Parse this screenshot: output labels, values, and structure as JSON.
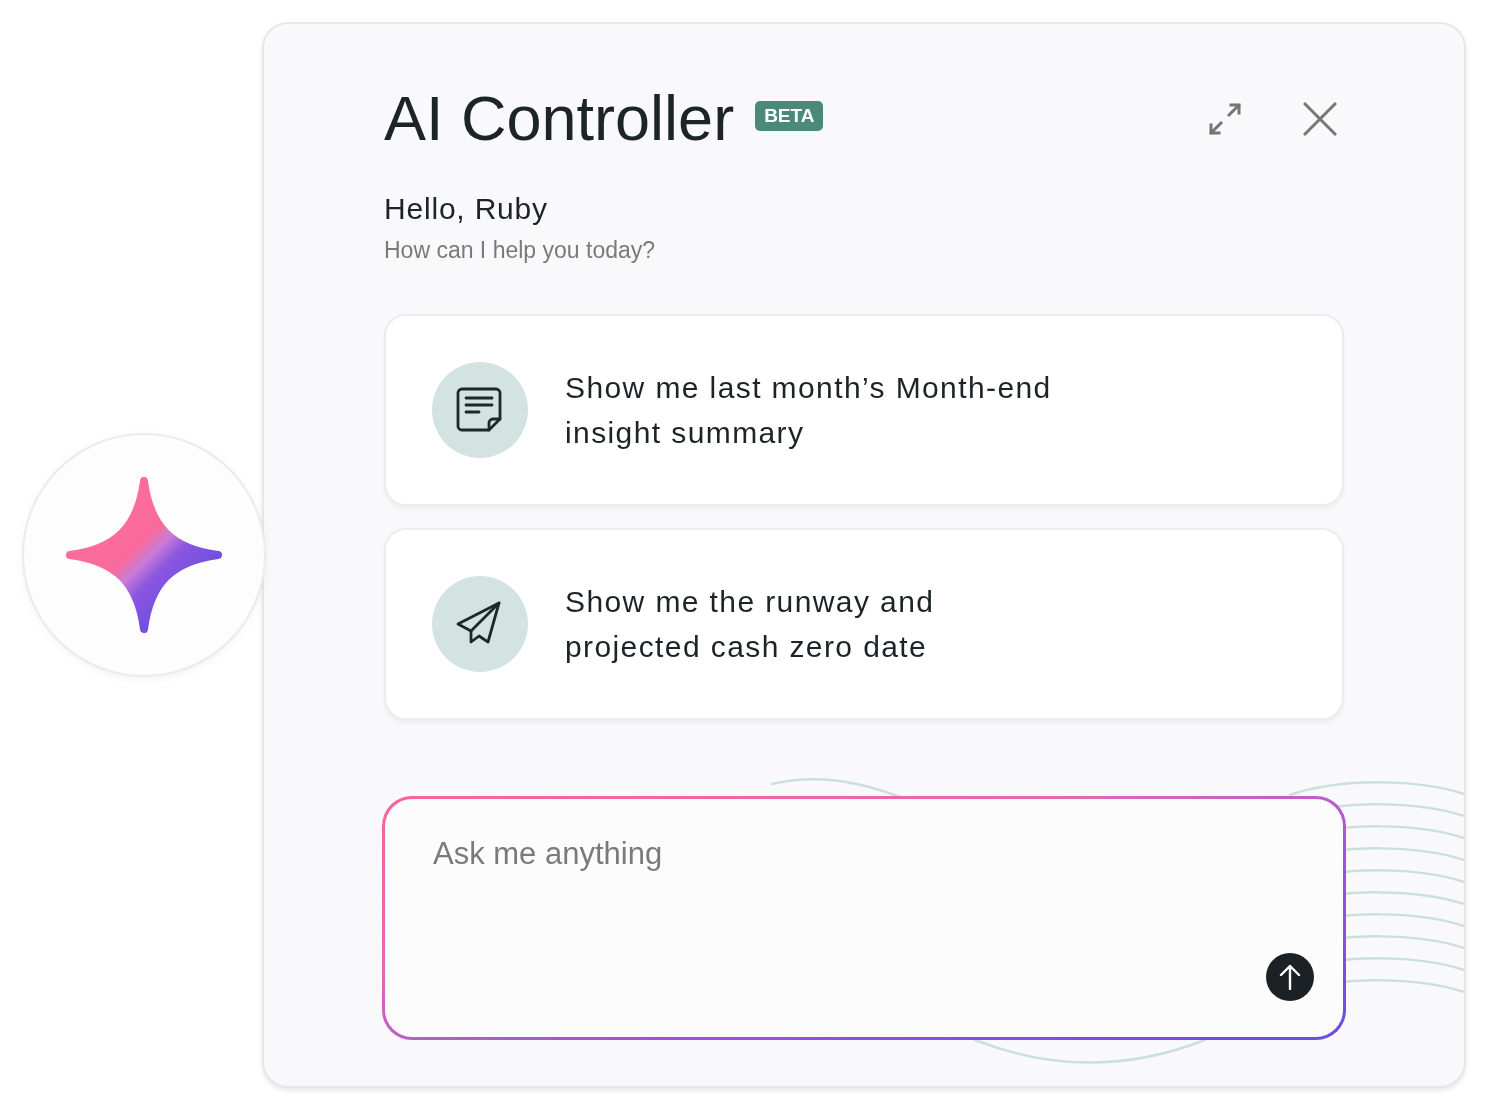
{
  "header": {
    "title": "AI Controller",
    "badge": "BETA"
  },
  "greeting": {
    "title": "Hello, Ruby",
    "subtitle": "How can I help you today?"
  },
  "suggestions": [
    {
      "kind": "note",
      "text": "Show me last month’s Month-end insight summary"
    },
    {
      "kind": "plane",
      "text": "Show me the runway and projected cash zero date"
    }
  ],
  "prompt": {
    "placeholder": "Ask me anything"
  }
}
